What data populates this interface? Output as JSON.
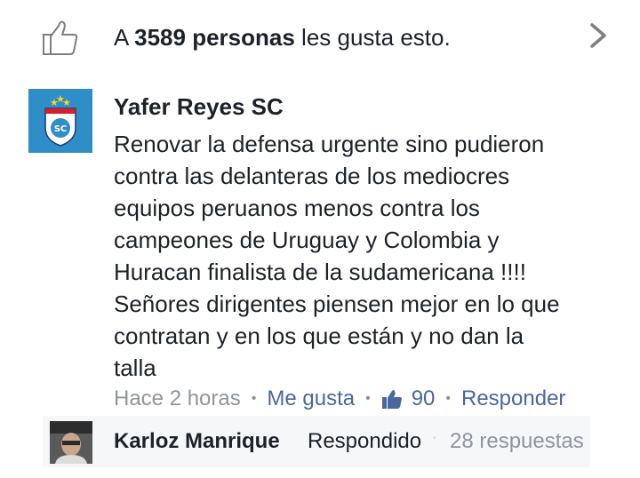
{
  "likes": {
    "prefix": "A ",
    "count_text": "3589 personas",
    "suffix": " les gusta esto."
  },
  "comment": {
    "author": "Yafer Reyes SC",
    "avatar_badge": "SC",
    "text": "Renovar la defensa urgente sino pudieron\ncontra las delanteras de los mediocres\nequipos peruanos menos contra los\ncampeones de Uruguay y Colombia y\nHuracan finalista de la sudamericana !!!!\nSeñores dirigentes piensen mejor en lo que\ncontratan y en los que están y no dan la\ntalla",
    "time": "Hace 2 horas",
    "like_action": "Me gusta",
    "like_count": "90",
    "reply_action": "Responder",
    "separator": "•"
  },
  "reply": {
    "author": "Karloz Manrique",
    "status": "Respondido",
    "separator": "·",
    "count": "28 respuestas"
  },
  "colors": {
    "link": "#4b67a1",
    "meta": "#90949c",
    "text": "#1d2129",
    "club_blue": "#2f8ec8",
    "reply_bg": "#f6f7f9"
  },
  "icons": {
    "likes_bar": "thumbs-up-outline-icon",
    "chevron": "chevron-right-icon",
    "like_count": "thumbs-up-filled-icon"
  }
}
